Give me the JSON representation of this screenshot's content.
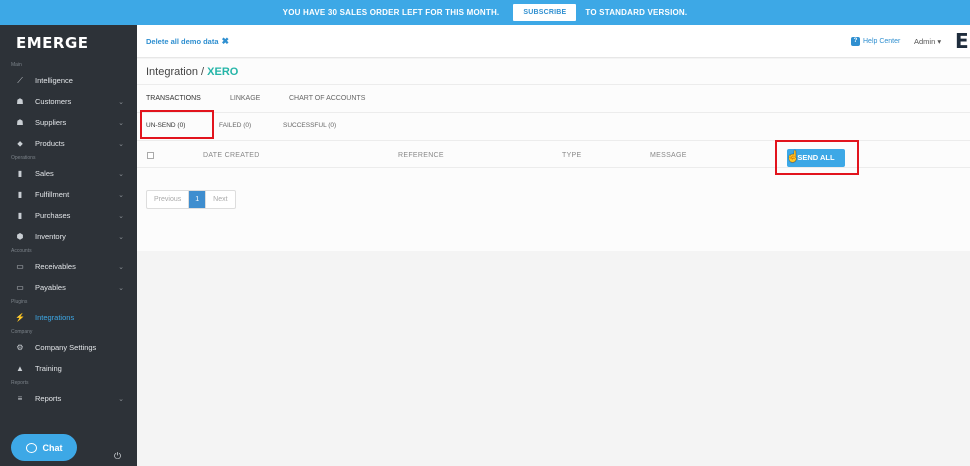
{
  "banner": {
    "message": "YOU HAVE 30 SALES ORDER LEFT FOR THIS MONTH.",
    "button": "SUBSCRIBE",
    "suffix": "TO STANDARD VERSION.",
    "bg_color": "#3da8e6"
  },
  "sidebar": {
    "logo": "EMERGE",
    "sections": [
      {
        "label": "Main",
        "items": [
          {
            "label": "Intelligence",
            "icon": "chart-line-icon",
            "chevron": false
          },
          {
            "label": "Customers",
            "icon": "users-icon",
            "chevron": true
          },
          {
            "label": "Suppliers",
            "icon": "users-icon",
            "chevron": true
          },
          {
            "label": "Products",
            "icon": "tag-icon",
            "chevron": true
          }
        ]
      },
      {
        "label": "Operations",
        "items": [
          {
            "label": "Sales",
            "icon": "book-icon",
            "chevron": true
          },
          {
            "label": "Fulfillment",
            "icon": "book-icon",
            "chevron": true
          },
          {
            "label": "Purchases",
            "icon": "book-icon",
            "chevron": true
          },
          {
            "label": "Inventory",
            "icon": "cubes-icon",
            "chevron": true
          }
        ]
      },
      {
        "label": "Accounts",
        "items": [
          {
            "label": "Receivables",
            "icon": "money-icon",
            "chevron": true
          },
          {
            "label": "Payables",
            "icon": "money-icon",
            "chevron": true
          }
        ]
      },
      {
        "label": "Plugins",
        "items": [
          {
            "label": "Integrations",
            "icon": "plug-icon",
            "chevron": false,
            "active": true
          }
        ]
      },
      {
        "label": "Company",
        "items": [
          {
            "label": "Company Settings",
            "icon": "gear-icon",
            "chevron": false
          },
          {
            "label": "Training",
            "icon": "graduation-cap-icon",
            "chevron": false
          }
        ]
      },
      {
        "label": "Reports",
        "items": [
          {
            "label": "Reports",
            "icon": "list-icon",
            "chevron": true
          }
        ]
      }
    ],
    "chat_label": "Chat"
  },
  "topbar": {
    "delete_demo": "Delete all demo data",
    "help": "Help Center",
    "admin": "Admin",
    "corner_letter": "E"
  },
  "page": {
    "title_prefix": "Integration /",
    "title_accent": "XERO",
    "accent_color": "#25b5a8",
    "tabs": [
      "TRANSACTIONS",
      "LINKAGE",
      "CHART OF ACCOUNTS"
    ],
    "active_tab": "TRANSACTIONS",
    "subtabs": [
      "UN-SEND (0)",
      "FAILED (0)",
      "SUCCESSFUL (0)"
    ],
    "columns": [
      "DATE CREATED",
      "REFERENCE",
      "TYPE",
      "MESSAGE"
    ],
    "send_all": "SEND ALL",
    "pagination": {
      "previous": "Previous",
      "current": "1",
      "next": "Next"
    }
  }
}
